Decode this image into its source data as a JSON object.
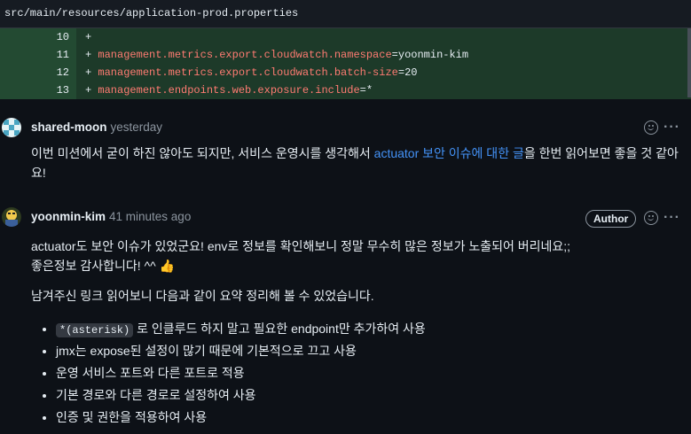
{
  "file": {
    "path": "src/main/resources/application-prod.properties"
  },
  "diff": {
    "lines": [
      {
        "num": "10",
        "prefix": "+",
        "key": "",
        "value": ""
      },
      {
        "num": "11",
        "prefix": "+",
        "key": "management.metrics.export.cloudwatch.namespace",
        "value": "=yoonmin-kim"
      },
      {
        "num": "12",
        "prefix": "+",
        "key": "management.metrics.export.cloudwatch.batch-size",
        "value": "=20"
      },
      {
        "num": "13",
        "prefix": "+",
        "key": "management.endpoints.web.exposure.include",
        "value": "=*"
      }
    ]
  },
  "comments": [
    {
      "author": "shared-moon",
      "time": "yesterday",
      "body_before": "이번 미션에서 굳이 하진 않아도 되지만, 서비스 운영시를 생각해서 ",
      "body_link": "actuator 보안 이슈에 대한 글",
      "body_after": "을 한번 읽어보면 좋을 것 같아요!",
      "icons": {
        "reaction": "smiley-icon",
        "menu": "kebab-icon"
      }
    },
    {
      "author": "yoonmin-kim",
      "time": "41 minutes ago",
      "badge": "Author",
      "para1_line1": "actuator도 보안 이슈가 있었군요! env로 정보를 확인해보니 정말 무수히 많은 정보가 노출되어 버리네요;;",
      "para1_line2": "좋은정보 감사합니다! ^^ 👍",
      "para2": "남겨주신 링크 읽어보니 다음과 같이 요약 정리해 볼 수 있었습니다.",
      "bullet1_code": "*(asterisk)",
      "bullet1_rest": " 로 인클루드 하지 말고 필요한 endpoint만 추가하여 사용",
      "bullets": [
        "jmx는 expose된 설정이 많기 때문에 기본적으로 끄고 사용",
        "운영 서비스 포트와 다른 포트로 적용",
        "기본 경로와 다른 경로로 설정하여 사용",
        "인증 및 권한을 적용하여 사용"
      ],
      "icons": {
        "reaction": "smiley-icon",
        "menu": "kebab-icon"
      }
    }
  ],
  "colors": {
    "link": "#4493f8",
    "diff_add_bg": "#1d3a29",
    "key": "#ff7b72"
  }
}
